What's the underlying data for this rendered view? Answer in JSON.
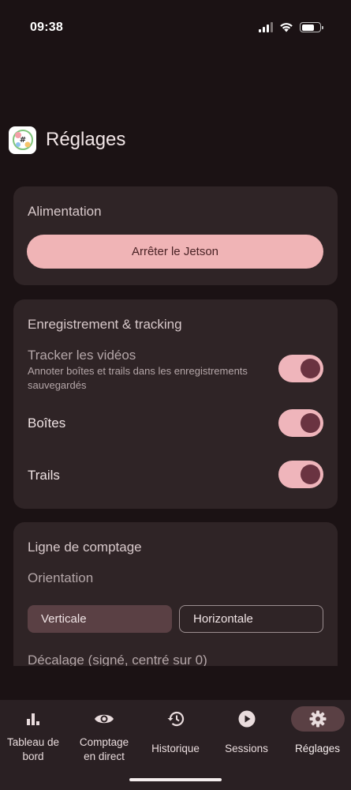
{
  "status_bar": {
    "time": "09:38",
    "battery_level": 0.72
  },
  "header": {
    "title": "Réglages",
    "logo_icon": "app-logo-icon"
  },
  "power_card": {
    "title": "Alimentation",
    "stop_button": "Arrêter le Jetson"
  },
  "recording_card": {
    "title": "Enregistrement & tracking",
    "track_videos": {
      "label": "Tracker les vidéos",
      "description": "Annoter boîtes et trails dans les enregistrements sauvegardés",
      "on": true
    },
    "boxes": {
      "label": "Boîtes",
      "on": true
    },
    "trails": {
      "label": "Trails",
      "on": true
    }
  },
  "counting_card": {
    "title": "Ligne de comptage",
    "orientation_label": "Orientation",
    "orientation_options": [
      "Verticale",
      "Horizontale"
    ],
    "orientation_selected": "Verticale",
    "offset_label": "Décalage (signé, centré sur 0)"
  },
  "bottom_nav": {
    "items": [
      {
        "label_line1": "Tableau de",
        "label_line2": "bord",
        "icon": "bar-chart-icon"
      },
      {
        "label_line1": "Comptage",
        "label_line2": "en direct",
        "icon": "eye-icon"
      },
      {
        "label_line1": "Historique",
        "label_line2": "",
        "icon": "history-icon"
      },
      {
        "label_line1": "Sessions",
        "label_line2": "",
        "icon": "play-circle-icon"
      },
      {
        "label_line1": "Réglages",
        "label_line2": "",
        "icon": "gear-icon"
      }
    ],
    "active": "Réglages"
  },
  "colors": {
    "background": "#1b1214",
    "card": "#2f2426",
    "accent": "#f0b4b6",
    "toggle_track": "#efb5bb",
    "toggle_knob": "#6a3341",
    "selected_segment": "#5a4044"
  }
}
